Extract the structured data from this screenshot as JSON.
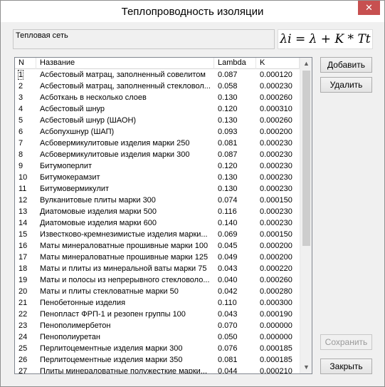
{
  "window": {
    "title": "Теплопроводность изоляции",
    "close_glyph": "✕"
  },
  "network_label": "Тепловая сеть",
  "formula": "λi = λ + K * Tt",
  "table": {
    "columns": [
      "N",
      "Название",
      "Lambda",
      "K"
    ],
    "selected_row": 0,
    "rows": [
      [
        "1",
        "Асбестовый матрац, заполненный совелитом",
        "0.087",
        "0.000120"
      ],
      [
        "2",
        "Асбестовый матрац, заполненный стекловол...",
        "0.058",
        "0.000230"
      ],
      [
        "3",
        "Асботкань в несколько слоев",
        "0.130",
        "0.000260"
      ],
      [
        "4",
        "Асбестовый шнур",
        "0.120",
        "0.000310"
      ],
      [
        "5",
        "Асбестовый шнур (ШАОН)",
        "0.130",
        "0.000260"
      ],
      [
        "6",
        "Асбопухшнур (ШАП)",
        "0.093",
        "0.000200"
      ],
      [
        "7",
        "Асбовермикулитовые изделия марки 250",
        "0.081",
        "0.000230"
      ],
      [
        "8",
        "Асбовермикулитовые изделия марки 300",
        "0.087",
        "0.000230"
      ],
      [
        "9",
        "Битумоперлит",
        "0.120",
        "0.000230"
      ],
      [
        "10",
        "Битумокерамзит",
        "0.130",
        "0.000230"
      ],
      [
        "11",
        "Битумовермикулит",
        "0.130",
        "0.000230"
      ],
      [
        "12",
        "Вулканитовые плиты марки 300",
        "0.074",
        "0.000150"
      ],
      [
        "13",
        "Диатомовые изделия марки 500",
        "0.116",
        "0.000230"
      ],
      [
        "14",
        "Диатомовые изделия марки 600",
        "0.140",
        "0.000230"
      ],
      [
        "15",
        "Известково-кремнезимистые изделия марки...",
        "0.069",
        "0.000150"
      ],
      [
        "16",
        "Маты минераловатные прошивные марки 100",
        "0.045",
        "0.000200"
      ],
      [
        "17",
        "Маты минераловатные прошивные марки 125",
        "0.049",
        "0.000200"
      ],
      [
        "18",
        "Маты и плиты из минеральной ваты марки 75",
        "0.043",
        "0.000220"
      ],
      [
        "19",
        "Маты и полосы из непрерывного стекловоло...",
        "0.040",
        "0.000260"
      ],
      [
        "20",
        "Маты и плиты стекловатные марки 50",
        "0.042",
        "0.000280"
      ],
      [
        "21",
        "Пенобетонные изделия",
        "0.110",
        "0.000300"
      ],
      [
        "22",
        "Пенопласт ФРП-1 и резопен группы 100",
        "0.043",
        "0.000190"
      ],
      [
        "23",
        "Пенополимербетон",
        "0.070",
        "0.000000"
      ],
      [
        "24",
        "Пенополиуретан",
        "0.050",
        "0.000000"
      ],
      [
        "25",
        "Перлитоцементные изделия марки 300",
        "0.076",
        "0.000185"
      ],
      [
        "26",
        "Перлитоцементные изделия марки 350",
        "0.081",
        "0.000185"
      ],
      [
        "27",
        "Плиты минераловатные полужесткие марки...",
        "0.044",
        "0.000210"
      ]
    ]
  },
  "scrollbar": {
    "up_glyph": "▲",
    "down_glyph": "▼",
    "position": 0.0
  },
  "buttons": {
    "add": "Добавить",
    "delete": "Удалить",
    "save": "Сохранить",
    "close": "Закрыть"
  }
}
